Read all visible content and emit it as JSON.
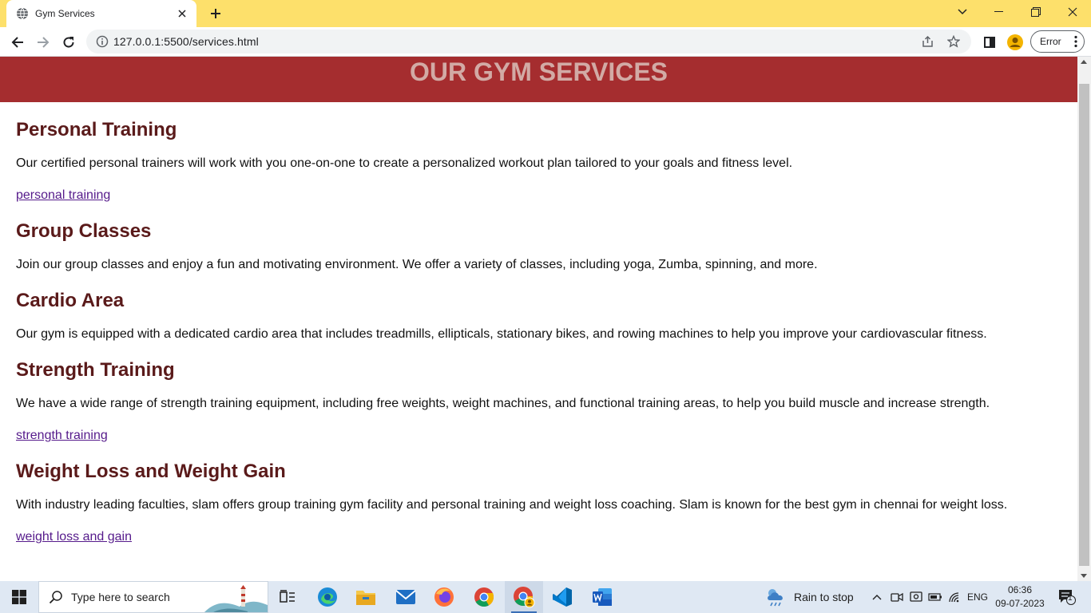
{
  "browser": {
    "tab_title": "Gym Services",
    "url": "127.0.0.1:5500/services.html",
    "profile_button_label": "Error"
  },
  "page": {
    "header_title": "OUR GYM SERVICES",
    "services": [
      {
        "title": "Personal Training",
        "description": "Our certified personal trainers will work with you one-on-one to create a personalized workout plan tailored to your goals and fitness level.",
        "link": "personal training"
      },
      {
        "title": "Group Classes",
        "description": "Join our group classes and enjoy a fun and motivating environment. We offer a variety of classes, including yoga, Zumba, spinning, and more."
      },
      {
        "title": "Cardio Area",
        "description": "Our gym is equipped with a dedicated cardio area that includes treadmills, ellipticals, stationary bikes, and rowing machines to help you improve your cardiovascular fitness."
      },
      {
        "title": "Strength Training",
        "description": "We have a wide range of strength training equipment, including free weights, weight machines, and functional training areas, to help you build muscle and increase strength.",
        "link": "strength training"
      },
      {
        "title": "Weight Loss and Weight Gain",
        "description": "With industry leading faculties, slam offers group training gym facility and personal training and weight loss coaching. Slam is known for the best gym in chennai for weight loss.",
        "link": "weight loss and gain"
      }
    ]
  },
  "taskbar": {
    "search_placeholder": "Type here to search",
    "weather_text": "Rain to stop",
    "language": "ENG",
    "time": "06:36",
    "date": "09-07-2023",
    "notification_count": "1"
  },
  "colors": {
    "header_bg": "#a52d2f",
    "header_text": "#d2aaa5",
    "heading": "#5a1a1a",
    "link": "#551a8b",
    "tabbar": "#fde06b"
  }
}
